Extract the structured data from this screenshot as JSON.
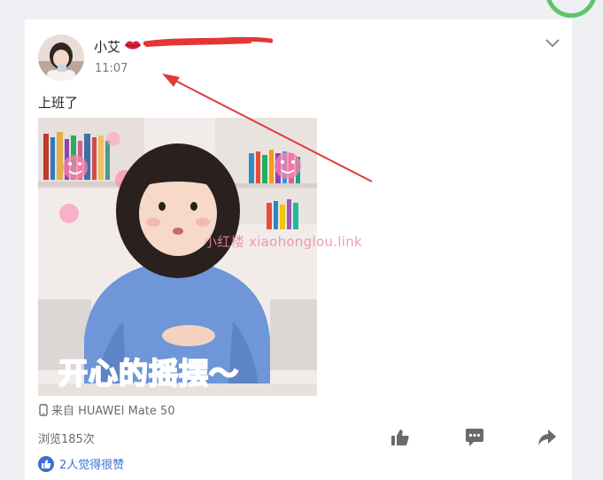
{
  "post": {
    "author_name": "小艾",
    "time": "11:07",
    "text": "上班了",
    "device_label": "来自 HUAWEI Mate 50",
    "views": "浏览185次",
    "likes_text": "2人觉得很赞"
  },
  "image": {
    "caption": "开心的摇摆～",
    "watermark": "小红楼  xiaohonglou.link"
  },
  "icons": {
    "menu": "chevron-down-icon",
    "like": "thumbs-up-icon",
    "comment": "comment-icon",
    "share": "share-arrow-icon",
    "device": "phone-icon",
    "emoji": "kiss-lips-icon"
  },
  "colors": {
    "accent_blue": "#3d6fd1",
    "annotation_red": "#e03a3a",
    "caption_pink": "#e9359a",
    "ring_green": "#5fc46a"
  }
}
